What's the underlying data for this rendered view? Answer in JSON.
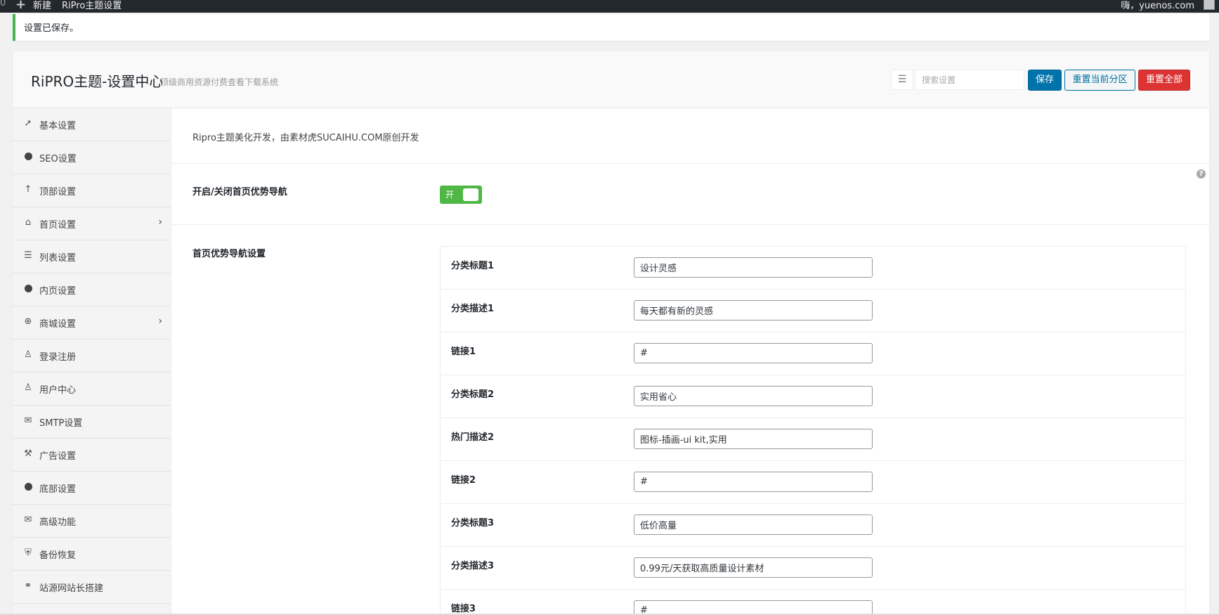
{
  "adminbar": {
    "left_num": "0",
    "new_label": "新建",
    "page_label": "RiPro主题设置",
    "greeting": "嗨，yuenos.com"
  },
  "notice": {
    "text": "设置已保存。"
  },
  "header": {
    "title": "RiPRO主题-设置中心",
    "subtitle": "顶级商用资源付费查看下载系统",
    "search_placeholder": "搜索设置",
    "save_label": "保存",
    "reset_section_label": "重置当前分区",
    "reset_all_label": "重置全部"
  },
  "sidebar": {
    "items": [
      {
        "label": "基本设置",
        "icon": "rocket-icon",
        "glyph": "➚"
      },
      {
        "label": "SEO设置",
        "icon": "circle-icon",
        "glyph": "dot"
      },
      {
        "label": "顶部设置",
        "icon": "arrow-up-icon",
        "glyph": "↑"
      },
      {
        "label": "首页设置",
        "icon": "home-icon",
        "glyph": "⌂",
        "has_children": true
      },
      {
        "label": "列表设置",
        "icon": "list-icon",
        "glyph": "☰"
      },
      {
        "label": "内页设置",
        "icon": "circle-icon",
        "glyph": "dot"
      },
      {
        "label": "商城设置",
        "icon": "plus-circle-icon",
        "glyph": "⊕",
        "has_children": true
      },
      {
        "label": "登录注册",
        "icon": "user-icon",
        "glyph": "♙"
      },
      {
        "label": "用户中心",
        "icon": "user-icon",
        "glyph": "♙"
      },
      {
        "label": "SMTP设置",
        "icon": "envelope-icon",
        "glyph": "✉"
      },
      {
        "label": "广告设置",
        "icon": "gavel-icon",
        "glyph": "⚒"
      },
      {
        "label": "底部设置",
        "icon": "circle-icon",
        "glyph": "dot"
      },
      {
        "label": "高级功能",
        "icon": "envelope-icon",
        "glyph": "✉"
      },
      {
        "label": "备份恢复",
        "icon": "shield-icon",
        "glyph": "⛨"
      },
      {
        "label": "站源网站长搭建",
        "icon": "handshake-icon",
        "glyph": "⚭"
      }
    ]
  },
  "content": {
    "intro": "Ripro主题美化开发，由素材虎SUCAIHU.COM原创开发",
    "toggle_field": {
      "title": "开启/关闭首页优势导航",
      "on_label": "开",
      "value": true
    },
    "group_field": {
      "title": "首页优势导航设置",
      "rows": [
        {
          "label": "分类标题1",
          "value": "设计灵感"
        },
        {
          "label": "分类描述1",
          "value": "每天都有新的灵感"
        },
        {
          "label": "链接1",
          "value": "#"
        },
        {
          "label": "分类标题2",
          "value": "实用省心"
        },
        {
          "label": "热门描述2",
          "value": "图标-插画-ui kit,实用"
        },
        {
          "label": "链接2",
          "value": "#"
        },
        {
          "label": "分类标题3",
          "value": "低价高量"
        },
        {
          "label": "分类描述3",
          "value": "0.99元/天获取高质量设计素材"
        },
        {
          "label": "链接3",
          "value": "#"
        }
      ]
    }
  },
  "colors": {
    "adminbar_bg": "#23282d",
    "notice_border": "#46b450",
    "save_btn": "#0073aa",
    "reset_all_btn": "#dd3333",
    "toggle_on": "#4fb845"
  }
}
